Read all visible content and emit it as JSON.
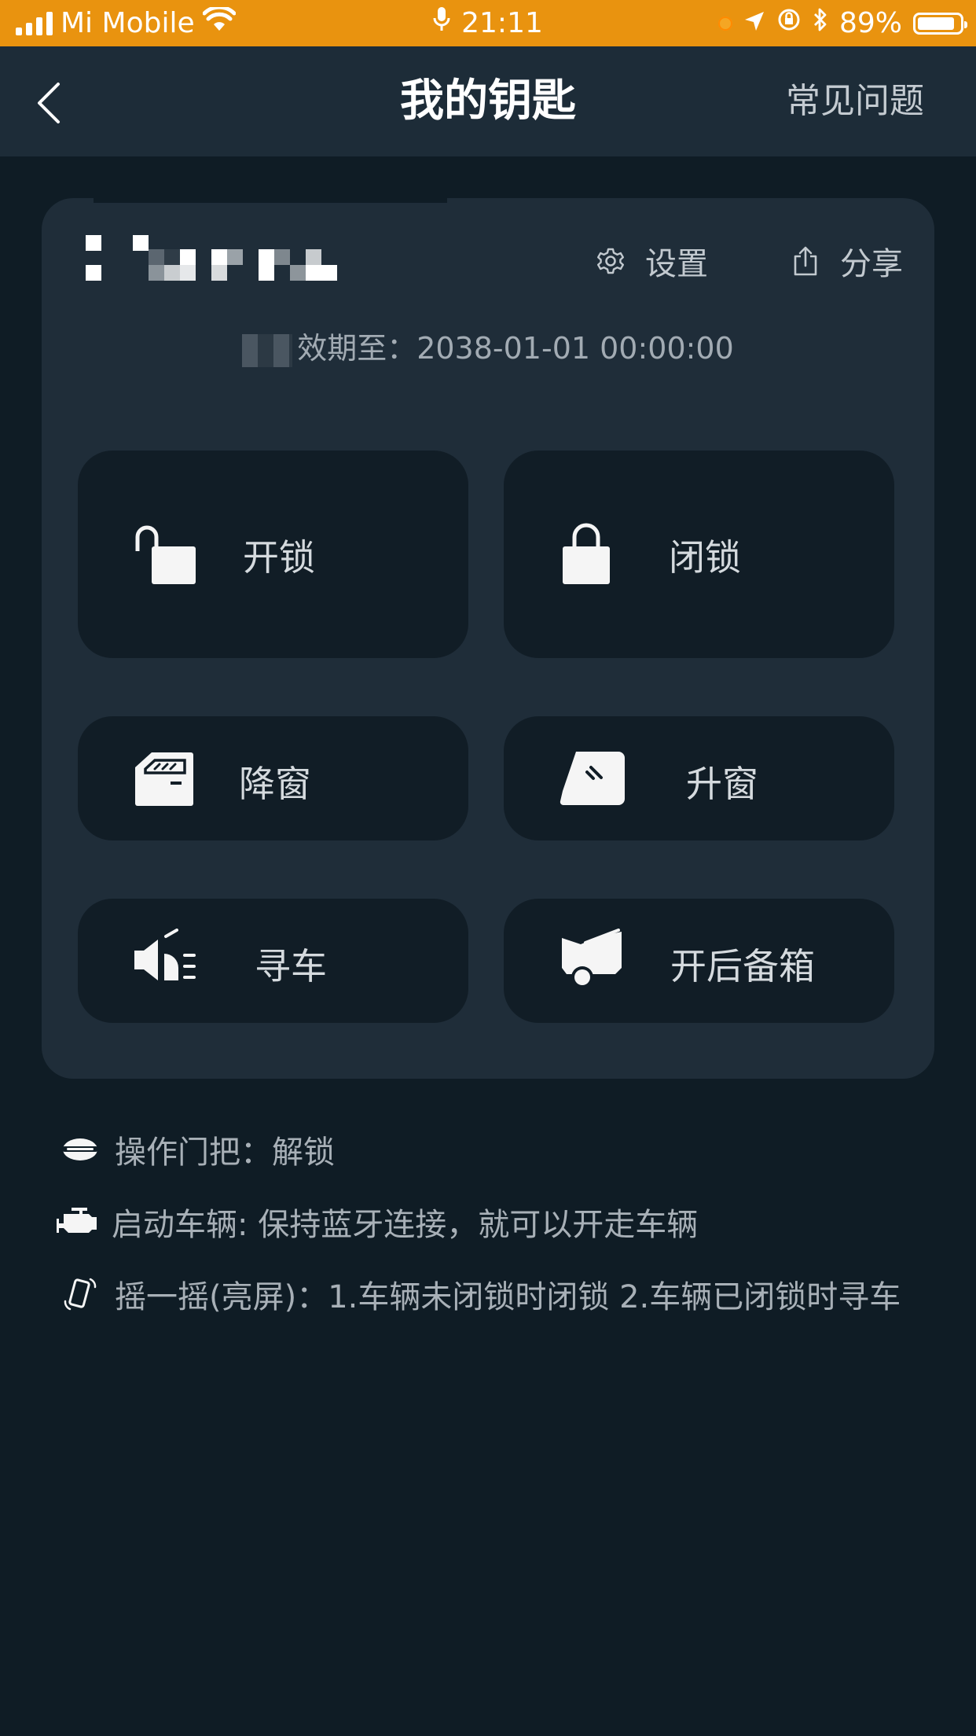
{
  "status_bar": {
    "carrier": "Mi Mobile",
    "time": "21:11",
    "battery_percent": "89%",
    "battery_level": 0.89
  },
  "nav": {
    "title": "我的钥匙",
    "faq_label": "常见问题"
  },
  "key_card": {
    "settings_label": "设置",
    "share_label": "分享",
    "validity_text": "效期至：2038-01-01 00:00:00"
  },
  "controls": {
    "unlock_label": "开锁",
    "lock_label": "闭锁",
    "window_down_label": "降窗",
    "window_up_label": "升窗",
    "find_car_label": "寻车",
    "open_trunk_label": "开后备箱"
  },
  "tips": {
    "door_handle": "操作门把：解锁",
    "start_vehicle": "启动车辆: 保持蓝牙连接，就可以开走车辆",
    "shake": "摇一摇(亮屏)：1.车辆未闭锁时闭锁 2.车辆已闭锁时寻车"
  },
  "colors": {
    "status_bar": "#e9930f",
    "background": "#0f1c25",
    "nav": "#1d2c38",
    "card": "#1f2d39",
    "button": "#111d26"
  }
}
